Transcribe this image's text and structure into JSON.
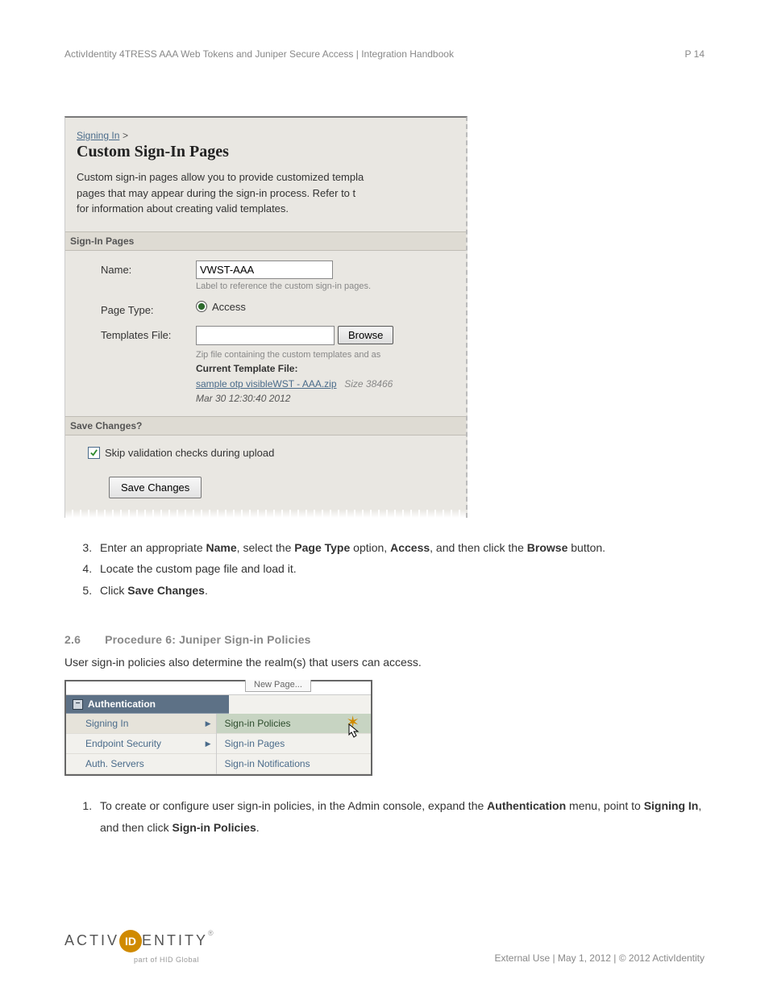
{
  "header": {
    "left": "ActivIdentity 4TRESS AAA Web Tokens and Juniper Secure Access | Integration Handbook",
    "right": "P 14"
  },
  "panel1": {
    "breadcrumb_link": "Signing In",
    "breadcrumb_sep": ">",
    "title": "Custom Sign-In Pages",
    "intro_l1": "Custom sign-in pages allow you to provide customized templa",
    "intro_l2": "pages that may appear during the sign-in process. Refer to t",
    "intro_l3": "for information about creating valid templates.",
    "section1": "Sign-In Pages",
    "name_label": "Name:",
    "name_value": "VWST-AAA",
    "name_help": "Label to reference the custom sign-in pages.",
    "pagetype_label": "Page Type:",
    "pagetype_value": "Access",
    "tmpl_label": "Templates File:",
    "browse_btn": "Browse",
    "tmpl_help": "Zip file containing the custom templates and as",
    "cur_tmpl_label": "Current Template File:",
    "tmpl_file_link": "sample otp visibleWST - AAA.zip",
    "tmpl_file_size": "Size 38466",
    "tmpl_file_date": "Mar 30 12:30:40 2012",
    "section2": "Save Changes?",
    "skip_label": "Skip validation checks during upload",
    "save_btn": "Save Changes"
  },
  "steps_a": {
    "s3_pre": "Enter an appropriate ",
    "s3_b1": "Name",
    "s3_mid1": ", select the ",
    "s3_b2": "Page Type",
    "s3_mid2": " option, ",
    "s3_b3": "Access",
    "s3_mid3": ", and then click the ",
    "s3_b4": "Browse",
    "s3_post": " button.",
    "s4": "Locate the custom page file and load it.",
    "s5_pre": "Click ",
    "s5_b": "Save Changes",
    "s5_post": "."
  },
  "sec26": {
    "num": "2.6",
    "title": "Procedure 6: Juniper Sign-in Policies",
    "intro": "User sign-in policies also determine the realm(s) that users can access."
  },
  "menu": {
    "partial_btn": "New Page...",
    "header": "Authentication",
    "left1": "Signing In",
    "left2": "Endpoint Security",
    "left3": "Auth. Servers",
    "right1": "Sign-in Policies",
    "right2": "Sign-in Pages",
    "right3": "Sign-in Notifications"
  },
  "steps_b": {
    "s1_pre": "To create or configure user sign-in policies, in the Admin console, expand the ",
    "s1_b1": "Authentication",
    "s1_mid1": " menu, point to ",
    "s1_b2": "Signing In",
    "s1_mid2": ", and then click ",
    "s1_b3": "Sign-in Policies",
    "s1_post": "."
  },
  "footer": {
    "text": "External Use | May 1, 2012 | © 2012 ActivIdentity",
    "logo_left": "ACTIV",
    "logo_mid": "ID",
    "logo_right": "ENTITY",
    "logo_sub": "part of HID Global"
  }
}
